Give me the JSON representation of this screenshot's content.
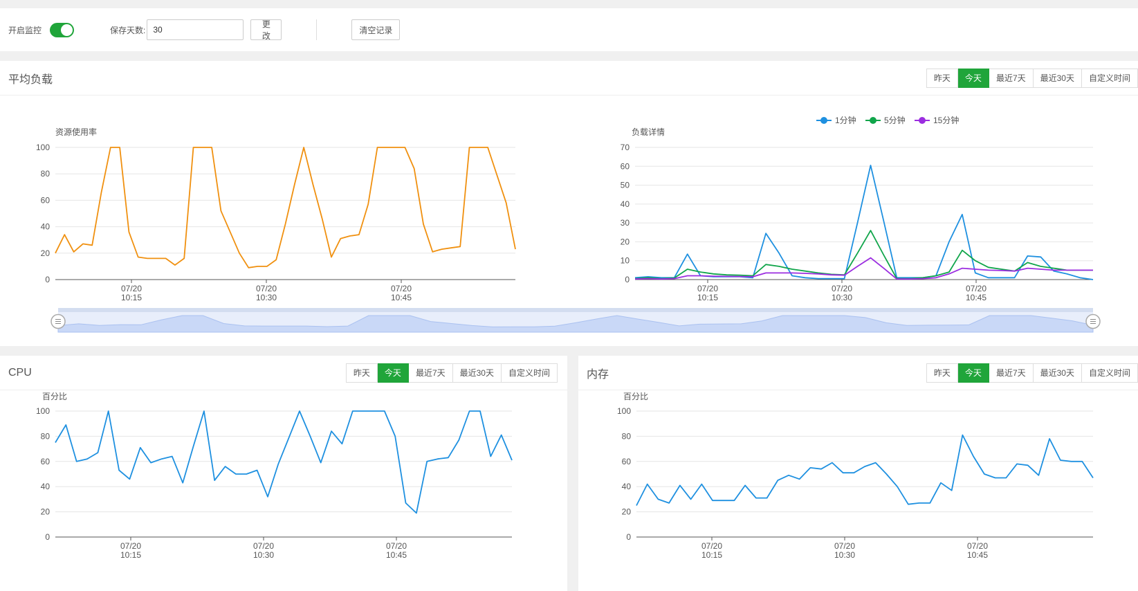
{
  "toolbar": {
    "monitor_label": "开启监控",
    "monitor_on": true,
    "days_label": "保存天数:",
    "days_value": "30",
    "edit_label": "更改",
    "clear_label": "清空记录"
  },
  "tabs": [
    "昨天",
    "今天",
    "最近7天",
    "最近30天",
    "自定义时间"
  ],
  "active_tab": "今天",
  "colors": {
    "accent": "#20a53a",
    "orange": "#f0900f",
    "blue": "#1e90e0",
    "green": "#10a54a",
    "purple": "#9b2de0"
  },
  "load_panel": {
    "title": "平均负载"
  },
  "cpu_panel": {
    "title": "CPU"
  },
  "mem_panel": {
    "title": "内存"
  },
  "chart_data": [
    {
      "id": "load-usage",
      "type": "line",
      "ylabel": "资源使用率",
      "ylim": [
        0,
        100
      ],
      "yticks": [
        0,
        20,
        40,
        60,
        80,
        100
      ],
      "xticks": [
        {
          "date": "07/20",
          "time": "10:15"
        },
        {
          "date": "07/20",
          "time": "10:30"
        },
        {
          "date": "07/20",
          "time": "10:45"
        }
      ],
      "series": [
        {
          "color": "#f0900f",
          "values": [
            20,
            34,
            21,
            27,
            26,
            66,
            100,
            100,
            36,
            17,
            16,
            16,
            16,
            11,
            16,
            100,
            100,
            100,
            52,
            36,
            20,
            9,
            10,
            10,
            15,
            42,
            72,
            100,
            72,
            46,
            17,
            31,
            33,
            34,
            57,
            100,
            100,
            100,
            100,
            84,
            42,
            21,
            23,
            24,
            25,
            100,
            100,
            100,
            79,
            58,
            23
          ]
        }
      ]
    },
    {
      "id": "load-detail",
      "type": "line",
      "ylabel": "负载详情",
      "ylim": [
        0,
        70
      ],
      "yticks": [
        0,
        10,
        20,
        30,
        40,
        50,
        60,
        70
      ],
      "xticks": [
        {
          "date": "07/20",
          "time": "10:15"
        },
        {
          "date": "07/20",
          "time": "10:30"
        },
        {
          "date": "07/20",
          "time": "10:45"
        }
      ],
      "legend": [
        "1分钟",
        "5分钟",
        "15分钟"
      ],
      "series": [
        {
          "name": "1分钟",
          "color": "#1e90e0",
          "values": [
            1,
            1.5,
            1,
            1,
            13.5,
            2,
            1.5,
            1.5,
            1.5,
            1,
            24.5,
            14,
            2,
            1,
            0.5,
            0.5,
            0.5,
            30,
            60.5,
            31,
            1,
            1,
            1,
            2,
            20,
            34.5,
            3.5,
            1,
            1,
            1,
            12.5,
            12,
            4.5,
            3,
            1,
            0
          ]
        },
        {
          "name": "5分钟",
          "color": "#10a54a",
          "values": [
            0.5,
            1,
            0.5,
            0.8,
            5.5,
            4,
            3,
            2.5,
            2.3,
            2,
            8,
            7,
            5.5,
            4.5,
            3.5,
            2.8,
            2.5,
            14,
            26,
            13,
            0.5,
            0.5,
            1,
            2,
            4,
            15.5,
            10,
            6.5,
            5.5,
            4.5,
            9,
            7,
            6,
            5,
            5,
            5
          ]
        },
        {
          "name": "15分钟",
          "color": "#9b2de0",
          "values": [
            0.3,
            0.5,
            0.3,
            0.5,
            2,
            2,
            1.8,
            1.7,
            1.6,
            1.5,
            3.5,
            3.5,
            3.5,
            3.3,
            3,
            2.5,
            2.3,
            7,
            11.5,
            6,
            0.3,
            0.3,
            0.5,
            1,
            3,
            6,
            5.5,
            5,
            4.8,
            4.5,
            6,
            5.5,
            5,
            5,
            5,
            5
          ]
        }
      ]
    },
    {
      "id": "cpu",
      "type": "line",
      "ylabel": "百分比",
      "ylim": [
        0,
        100
      ],
      "yticks": [
        0,
        20,
        40,
        60,
        80,
        100
      ],
      "xticks": [
        {
          "date": "07/20",
          "time": "10:15"
        },
        {
          "date": "07/20",
          "time": "10:30"
        },
        {
          "date": "07/20",
          "time": "10:45"
        }
      ],
      "series": [
        {
          "color": "#1e90e0",
          "values": [
            75,
            89,
            60,
            62,
            67,
            100,
            53,
            46,
            71,
            59,
            62,
            64,
            43,
            72,
            100,
            45,
            56,
            50,
            50,
            53,
            32,
            58,
            79,
            100,
            80,
            59,
            84,
            74,
            100,
            100,
            100,
            100,
            80,
            27,
            19,
            60,
            62,
            63,
            77,
            100,
            100,
            64,
            81,
            61
          ]
        }
      ]
    },
    {
      "id": "mem",
      "type": "line",
      "ylabel": "百分比",
      "ylim": [
        0,
        100
      ],
      "yticks": [
        0,
        20,
        40,
        60,
        80,
        100
      ],
      "xticks": [
        {
          "date": "07/20",
          "time": "10:15"
        },
        {
          "date": "07/20",
          "time": "10:30"
        },
        {
          "date": "07/20",
          "time": "10:45"
        }
      ],
      "series": [
        {
          "color": "#1e90e0",
          "values": [
            25,
            42,
            30,
            27,
            41,
            30,
            42,
            29,
            29,
            29,
            41,
            31,
            31,
            45,
            49,
            46,
            55,
            54,
            59,
            51,
            51,
            56,
            59,
            50,
            40,
            26,
            27,
            27,
            43,
            37,
            81,
            64,
            50,
            47,
            47,
            58,
            57,
            49,
            78,
            61,
            60,
            60,
            47
          ]
        }
      ]
    }
  ]
}
